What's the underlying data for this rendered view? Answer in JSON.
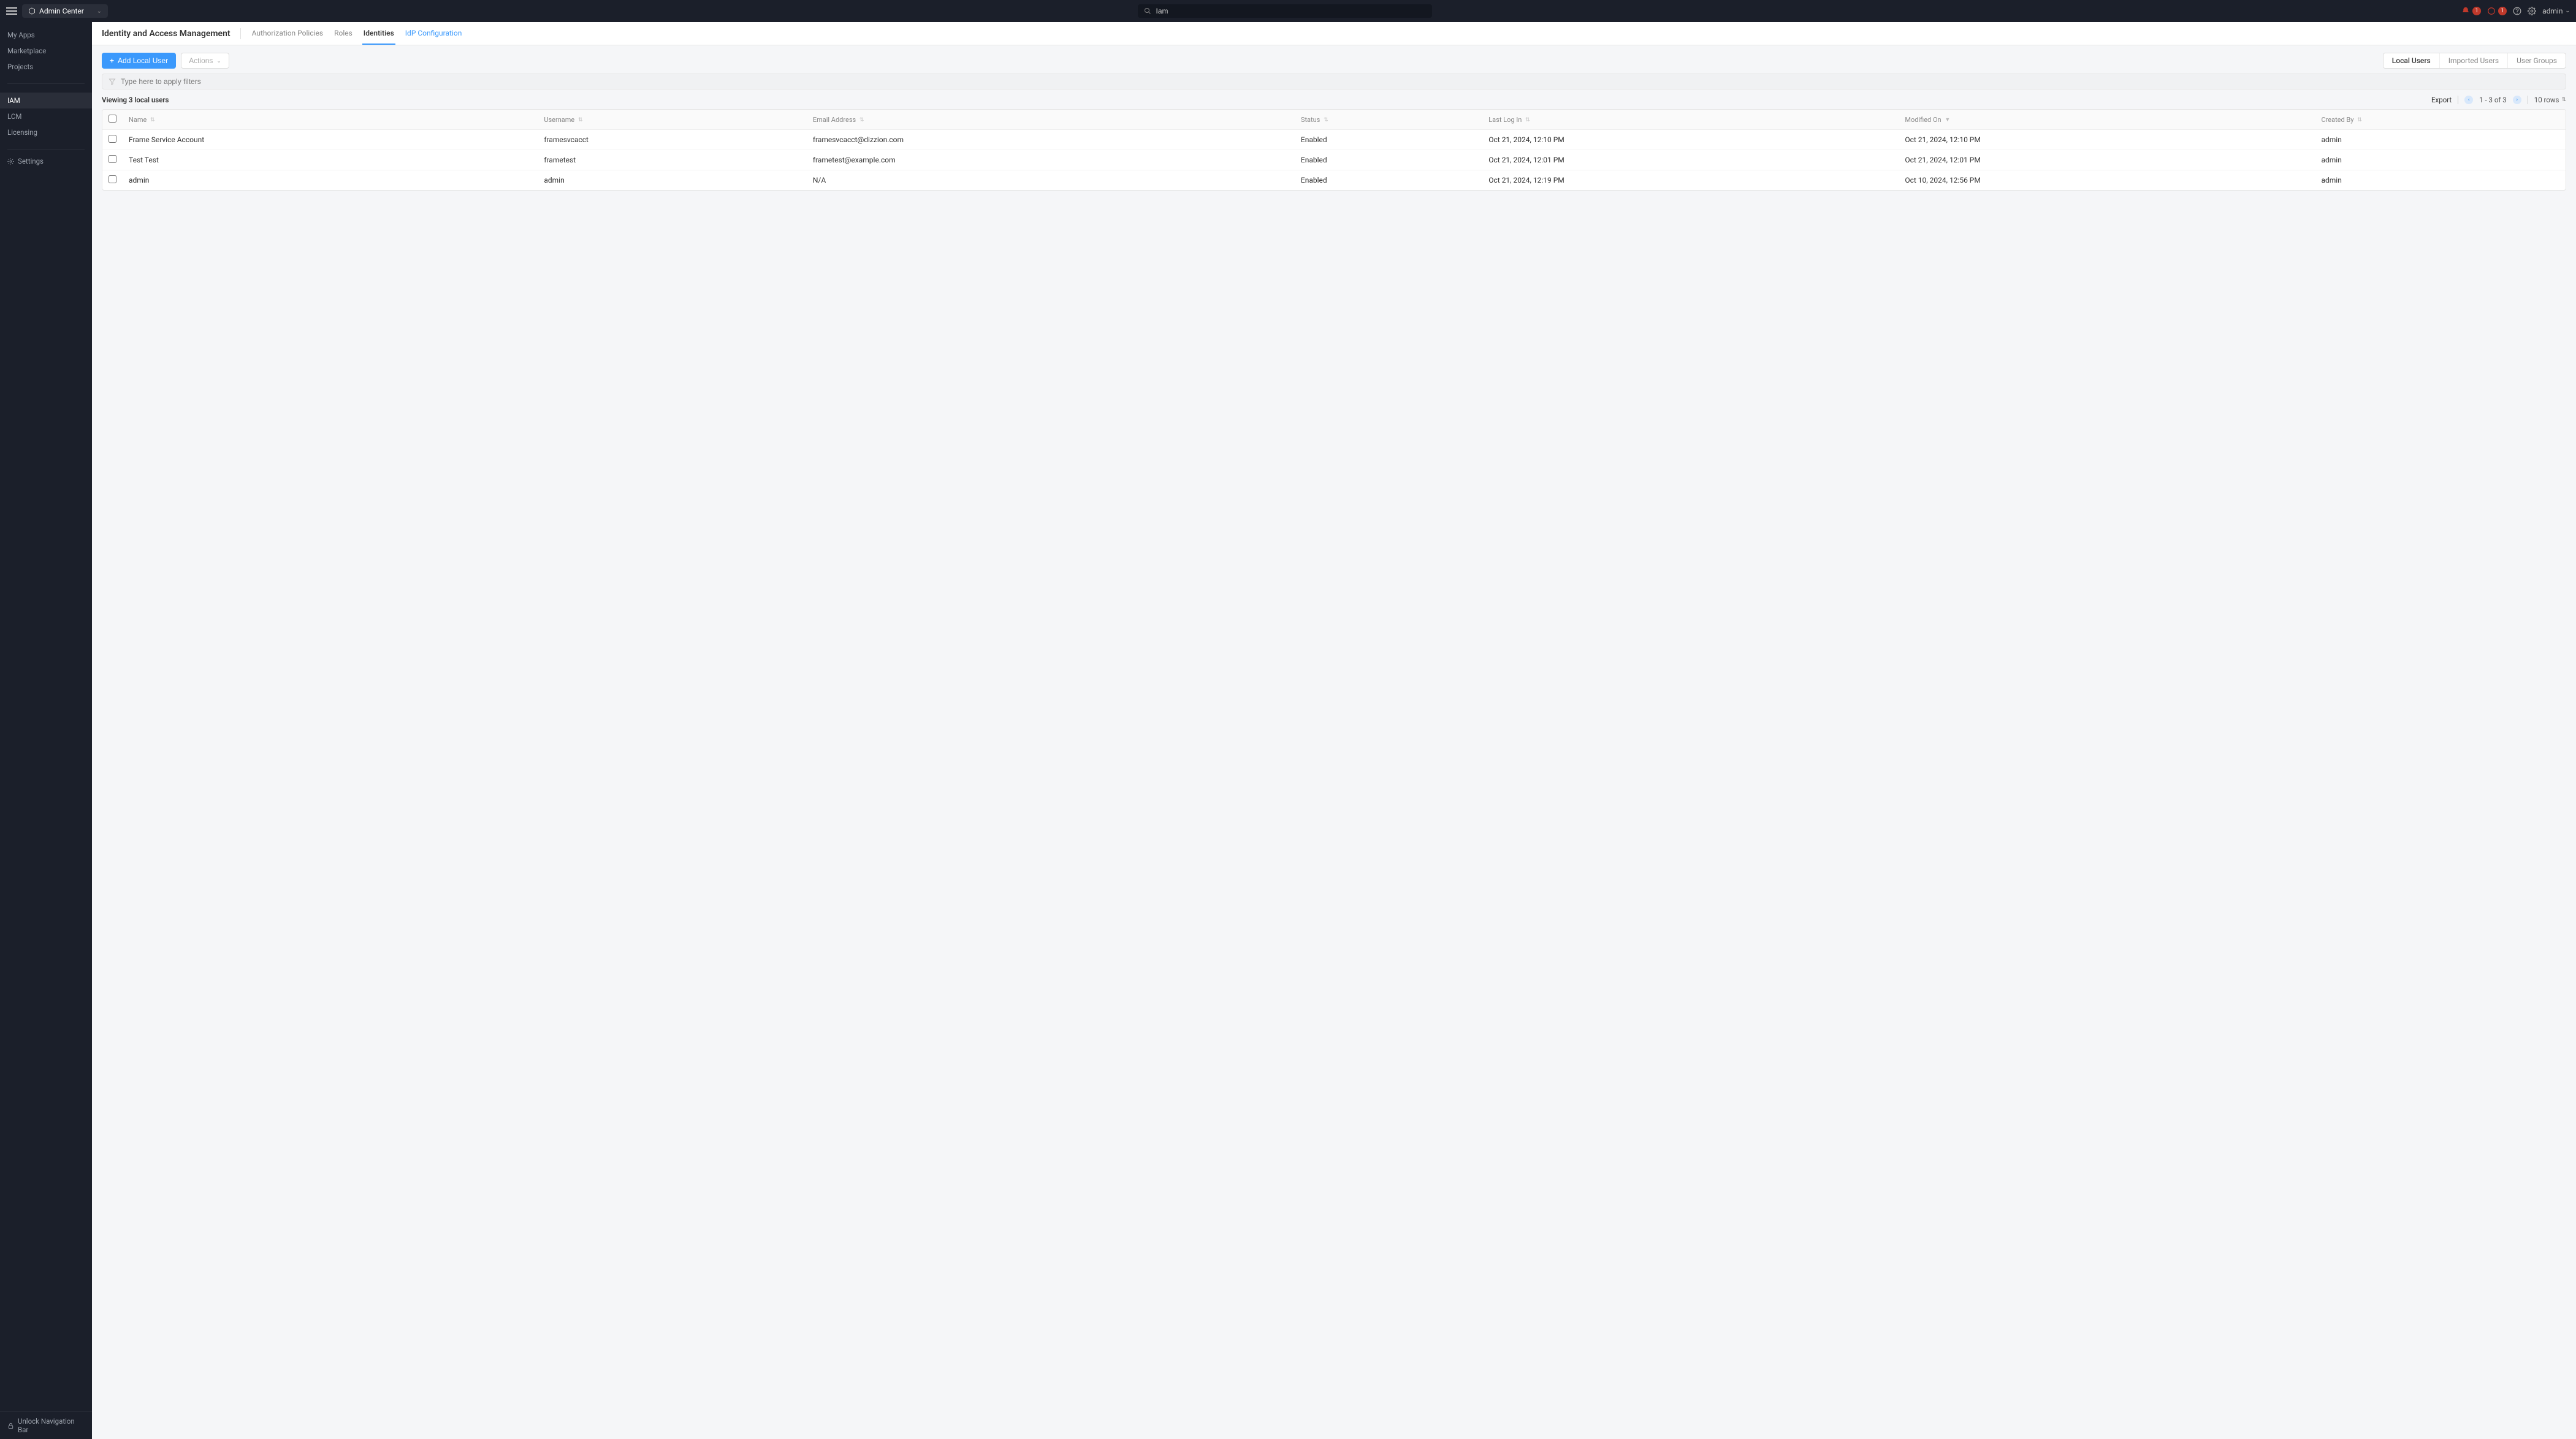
{
  "topbar": {
    "app_switcher_label": "Admin Center",
    "search_value": "Iam",
    "notif_badge": "1",
    "alert_badge": "1",
    "user_label": "admin"
  },
  "sidebar": {
    "group1": [
      "My Apps",
      "Marketplace",
      "Projects"
    ],
    "group2": [
      "IAM",
      "LCM",
      "Licensing"
    ],
    "active": "IAM",
    "settings_label": "Settings",
    "unlock_label": "Unlock Navigation Bar"
  },
  "header": {
    "title": "Identity and Access Management",
    "tabs": [
      "Authorization Policies",
      "Roles",
      "Identities",
      "IdP Configuration"
    ],
    "active_tab": "Identities"
  },
  "toolbar": {
    "add_label": "Add Local User",
    "actions_label": "Actions",
    "seg_tabs": [
      "Local Users",
      "Imported Users",
      "User Groups"
    ],
    "seg_active": "Local Users"
  },
  "filter": {
    "placeholder": "Type here to apply filters"
  },
  "status": {
    "viewing": "Viewing 3 local users",
    "export": "Export",
    "range": "1 - 3 of 3",
    "rows": "10 rows"
  },
  "columns": [
    "Name",
    "Username",
    "Email Address",
    "Status",
    "Last Log In",
    "Modified On",
    "Created By"
  ],
  "sort_column": "Modified On",
  "rows": [
    {
      "name": "Frame Service Account",
      "username": "framesvcacct",
      "email": "framesvcacct@dizzion.com",
      "status": "Enabled",
      "last_login": "Oct 21, 2024, 12:10 PM",
      "modified": "Oct 21, 2024, 12:10 PM",
      "created_by": "admin"
    },
    {
      "name": "Test Test",
      "username": "frametest",
      "email": "frametest@example.com",
      "status": "Enabled",
      "last_login": "Oct 21, 2024, 12:01 PM",
      "modified": "Oct 21, 2024, 12:01 PM",
      "created_by": "admin"
    },
    {
      "name": "admin",
      "username": "admin",
      "email": "N/A",
      "status": "Enabled",
      "last_login": "Oct 21, 2024, 12:19 PM",
      "modified": "Oct 10, 2024, 12:56 PM",
      "created_by": "admin"
    }
  ]
}
